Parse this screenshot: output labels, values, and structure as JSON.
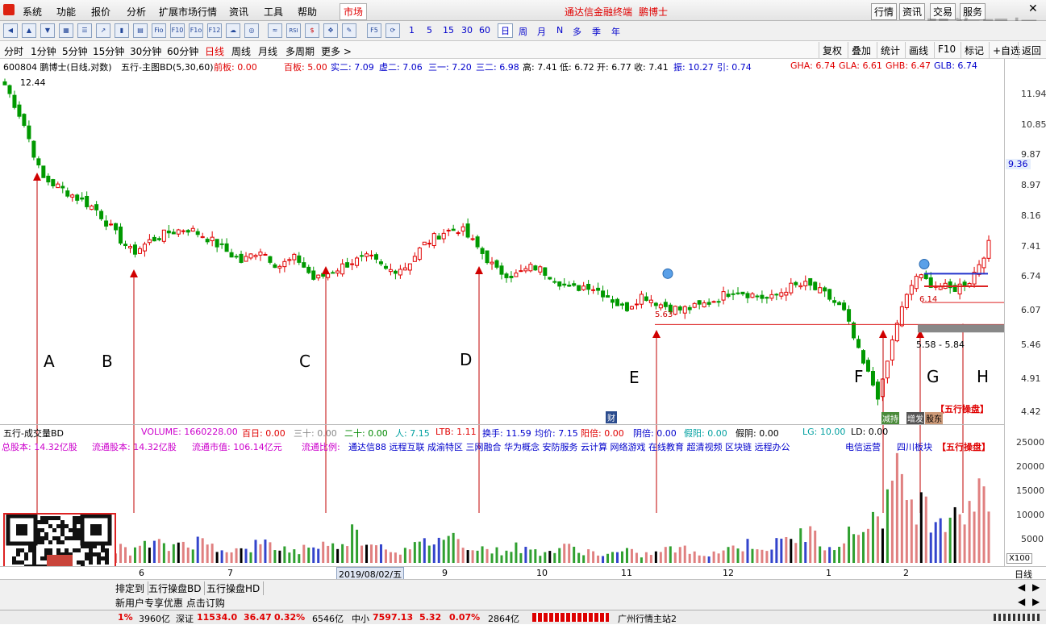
{
  "menu": {
    "items": [
      "系统",
      "功能",
      "报价",
      "分析",
      "扩展市场行情",
      "资讯",
      "工具",
      "帮助"
    ],
    "market_tab": "市场",
    "app_title": "通达信金融终端",
    "stock_title": "鹏博士",
    "right_buttons": [
      "行情",
      "资讯",
      "交易",
      "服务"
    ],
    "watermark": "股海明灯"
  },
  "toolbar": {
    "buttons": [
      "Fio",
      "F10",
      "F1o",
      "F12",
      "F5"
    ],
    "numbers": [
      "1",
      "5",
      "15",
      "30",
      "60"
    ],
    "periods_short": [
      "日",
      "周",
      "月",
      "N",
      "多",
      "季",
      "年"
    ]
  },
  "periodbar": {
    "items": [
      "分时",
      "1分钟",
      "5分钟",
      "15分钟",
      "30分钟",
      "60分钟",
      "日线",
      "周线",
      "月线",
      "多周期",
      "更多 >"
    ],
    "active": "日线",
    "right": [
      "复权",
      "叠加",
      "统计",
      "画线",
      "F10",
      "标记",
      "+自选",
      "返回"
    ]
  },
  "infobar": {
    "code_name": "600804 鹏博士(日线,对数)",
    "indicator": "五行-主图BD(5,30,60)",
    "qianban": "前板: 0.00",
    "baiban": "百板: 5.00",
    "shier": "实二: 7.09",
    "xuer": "虚二: 7.06",
    "sanyi": "三一: 7.20",
    "saner": "三二: 6.98",
    "high": "高: 7.41",
    "low": "低: 6.72",
    "open": "开: 6.77",
    "close": "收: 7.41",
    "amplitude": "振: 10.27",
    "yin": "引: 0.74",
    "gha": "GHA: 6.74",
    "gla": "GLA: 6.61",
    "ghb": "GHB: 6.47",
    "glb": "GLB: 6.74"
  },
  "price_axis": [
    "11.94",
    "10.85",
    "9.87",
    "8.97",
    "8.16",
    "7.41",
    "6.74",
    "6.07",
    "5.46",
    "4.91",
    "4.42"
  ],
  "current_price": "9.36",
  "chart_labels": {
    "top_price": "12.44",
    "box_low": "5.63",
    "g_price": "6.14",
    "range": "5.58 - 5.84",
    "wuxing": "【五行操盘】",
    "cai": "财",
    "tags": [
      "减持",
      "增发",
      "股东"
    ]
  },
  "annotations": [
    "A",
    "B",
    "C",
    "D",
    "E",
    "F",
    "G",
    "H"
  ],
  "volume": {
    "title": "五行-成交量BD",
    "volume": "VOLUME: 1660228.00",
    "bairi": "百日: 0.00",
    "sanshi": "三十: 0.00",
    "ershi": "二十: 0.00",
    "ren": "人: 7.15",
    "ltb": "LTB: 1.11",
    "huanshou": "换手: 11.59",
    "junjia": "均价: 7.15",
    "yangbei": "阳倍: 0.00",
    "yinbei": "阴倍: 0.00",
    "jiayang": "假阳: 0.00",
    "jiayin": "假阴: 0.00",
    "lg": "LG: 10.00",
    "ld": "LD: 0.00",
    "zong": "总股本: 14.32亿股",
    "liutong": "流通股本: 14.32亿股",
    "shizhi": "流通市值: 106.14亿元",
    "bili": "流通比例:",
    "concepts": "通达信88 远程互联 成渝特区 三网融合 华为概念 安防服务 云计算 网络游戏 在线教育 超清视频 区块链 远程办公",
    "industry": "电信运营",
    "sector": "四川板块",
    "wuxing": "【五行操盘】",
    "axis": [
      "25000",
      "20000",
      "15000",
      "10000",
      "5000"
    ],
    "unit": "X100"
  },
  "datebar": {
    "dates": [
      "6",
      "7",
      "2019/08/02/五",
      "9",
      "10",
      "11",
      "12",
      "1",
      "2"
    ],
    "cycle": "日线"
  },
  "bottomtabs": [
    "排定到",
    "五行操盘BD",
    "五行操盘HD"
  ],
  "promo": "新用户专享优惠 点击订购",
  "status": {
    "pct": "1%",
    "amt1": "3960亿",
    "sz_label": "深证",
    "sz_val": "11534.0",
    "sz_chg": "36.47",
    "sz_pct": "0.32%",
    "amt2": "6546亿",
    "zx_label": "中小",
    "zx_val": "7597.13",
    "zx_chg": "5.32",
    "zx_pct": "0.07%",
    "amt3": "2864亿",
    "server": "广州行情主站2"
  },
  "colors": {
    "up": "#e00000",
    "down": "#009900",
    "axis_bg": "#ffffff",
    "accent": "#cc00cc"
  },
  "chart_data": {
    "type": "candlestick",
    "ylabel": "",
    "ylim": [
      4.2,
      12.6
    ],
    "scale": "log",
    "close_path": [
      12.4,
      11.0,
      9.2,
      8.9,
      8.6,
      8.3,
      7.7,
      7.2,
      7.5,
      7.7,
      7.8,
      7.6,
      7.3,
      7.0,
      7.3,
      6.9,
      7.1,
      6.6,
      6.8,
      7.0,
      7.1,
      6.8,
      6.9,
      7.4,
      7.7,
      7.8,
      7.3,
      6.8,
      6.7,
      6.9,
      6.7,
      6.4,
      6.5,
      6.3,
      6.0,
      6.3,
      6.1,
      6.0,
      6.05,
      6.2,
      6.4,
      6.3,
      6.2,
      6.45,
      6.5,
      6.3,
      6.0,
      5.1,
      4.5,
      5.8,
      6.7,
      6.5,
      6.4,
      6.6,
      7.4
    ],
    "volume_path": [
      4000,
      6000,
      3000,
      4000,
      7000,
      5000,
      4000,
      3000,
      5000,
      4000,
      6000,
      5000,
      4000,
      3000,
      5000,
      4000,
      3000,
      5000,
      4000,
      8000,
      6000,
      4000,
      3000,
      5000,
      7000,
      6000,
      4000,
      3000,
      4000,
      3000,
      3000,
      4000,
      3000,
      2000,
      3000,
      2000,
      3000,
      4000,
      2000,
      3000,
      4000,
      5000,
      4000,
      6000,
      8000,
      5000,
      6000,
      9000,
      13000,
      21000,
      16000,
      12000,
      14000,
      16000,
      17000
    ]
  }
}
